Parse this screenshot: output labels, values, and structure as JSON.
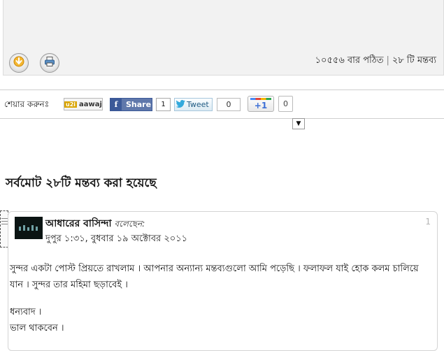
{
  "post_footer": {
    "read_count": "১০৫৫৬ বার পঠিত",
    "separator": "|",
    "comment_count": "২৮ টি মন্তব্য",
    "buttons": [
      {
        "icon": "favorite-arrow-icon"
      },
      {
        "icon": "print-icon"
      }
    ]
  },
  "share": {
    "label": "শেয়ার করুনঃ",
    "aawaj": {
      "mark": "u2i",
      "label": "aawaj"
    },
    "facebook": {
      "icon": "f",
      "label": "Share",
      "count": "1"
    },
    "twitter": {
      "label": "Tweet",
      "count": "0"
    },
    "google": {
      "label": "+1",
      "count": "0"
    },
    "toggle_icon": "▼"
  },
  "comments": {
    "heading": "সর্বমোট ২৮টি মন্তব্য করা হয়েছে",
    "items": [
      {
        "author": "আধারের বাসিন্দা",
        "says": "বলেছেন:",
        "time": "দুপুর ১:৩১, বুধবার ১৯ অক্টোবর ২০১১",
        "number": "1",
        "body": [
          "সুন্দর একটা পোস্ট প্রিয়তে রাখলাম । আপনার অন্যান্য মন্তব্যগুলো আমি পড়েছি । ফলাফল যাই হোক কলম চালিয়ে যান । সুন্দর তার মহিমা ছড়াবেই ।",
          "ধন্যবাদ ।",
          "ভাল থাকবেন ।"
        ]
      }
    ]
  },
  "colors": {
    "facebook": "#5f78ab",
    "twitter_text": "#1e5a82",
    "footer_bg": "#f2f2f2"
  }
}
